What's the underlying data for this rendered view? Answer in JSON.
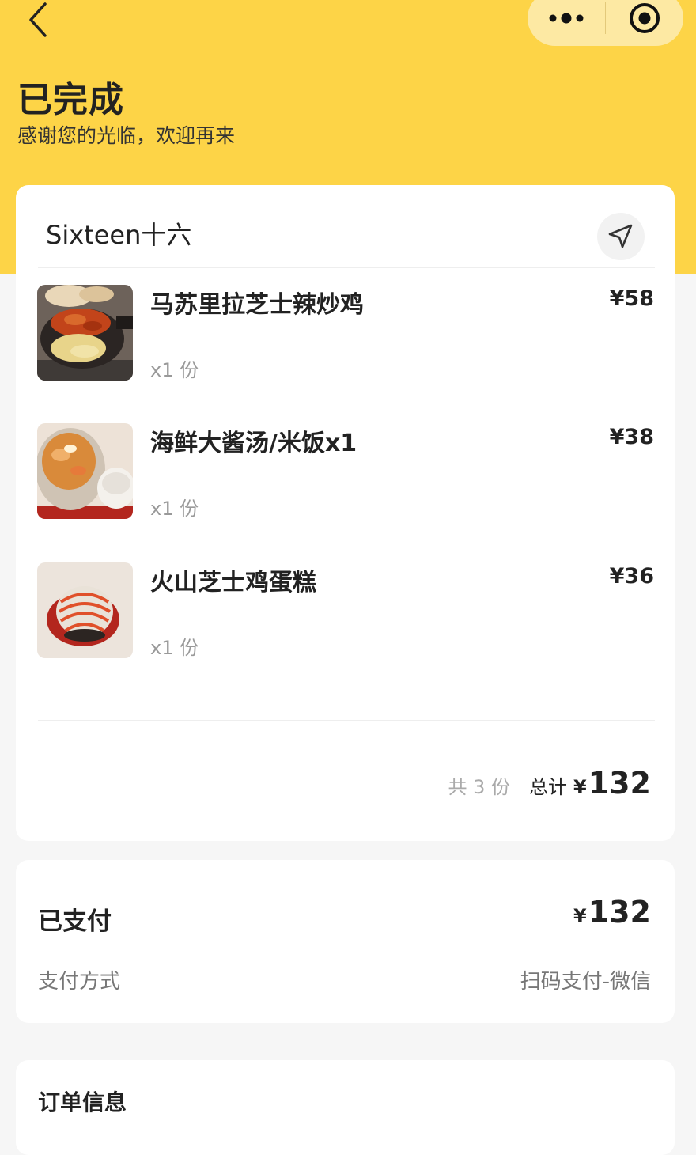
{
  "header": {
    "status_title": "已完成",
    "status_subtitle": "感谢您的光临，欢迎再来",
    "background_color": "#fdd447"
  },
  "order": {
    "shop_name": "Sixteen十六",
    "items": [
      {
        "name": "马苏里拉芝士辣炒鸡",
        "quantity": "x1 份",
        "price": "¥58",
        "image": "spicy-chicken-skillet"
      },
      {
        "name": "海鲜大酱汤/米饭x1",
        "quantity": "x1 份",
        "price": "¥38",
        "image": "seafood-soybean-soup-with-rice"
      },
      {
        "name": "火山芝士鸡蛋糕",
        "quantity": "x1 份",
        "price": "¥36",
        "image": "volcano-cheese-egg-cake"
      }
    ],
    "summary": {
      "count_text": "共 3 份",
      "total_label": "总计",
      "currency": "¥",
      "total_value": "132"
    }
  },
  "payment": {
    "status": "已支付",
    "currency": "¥",
    "amount": "132",
    "method_label": "支付方式",
    "method_value": "扫码支付-微信"
  },
  "order_info": {
    "title": "订单信息"
  },
  "icons": {
    "back": "chevron-left-icon",
    "more": "more-dots-icon",
    "close": "target-circle-icon",
    "navigate": "navigation-arrow-icon"
  }
}
